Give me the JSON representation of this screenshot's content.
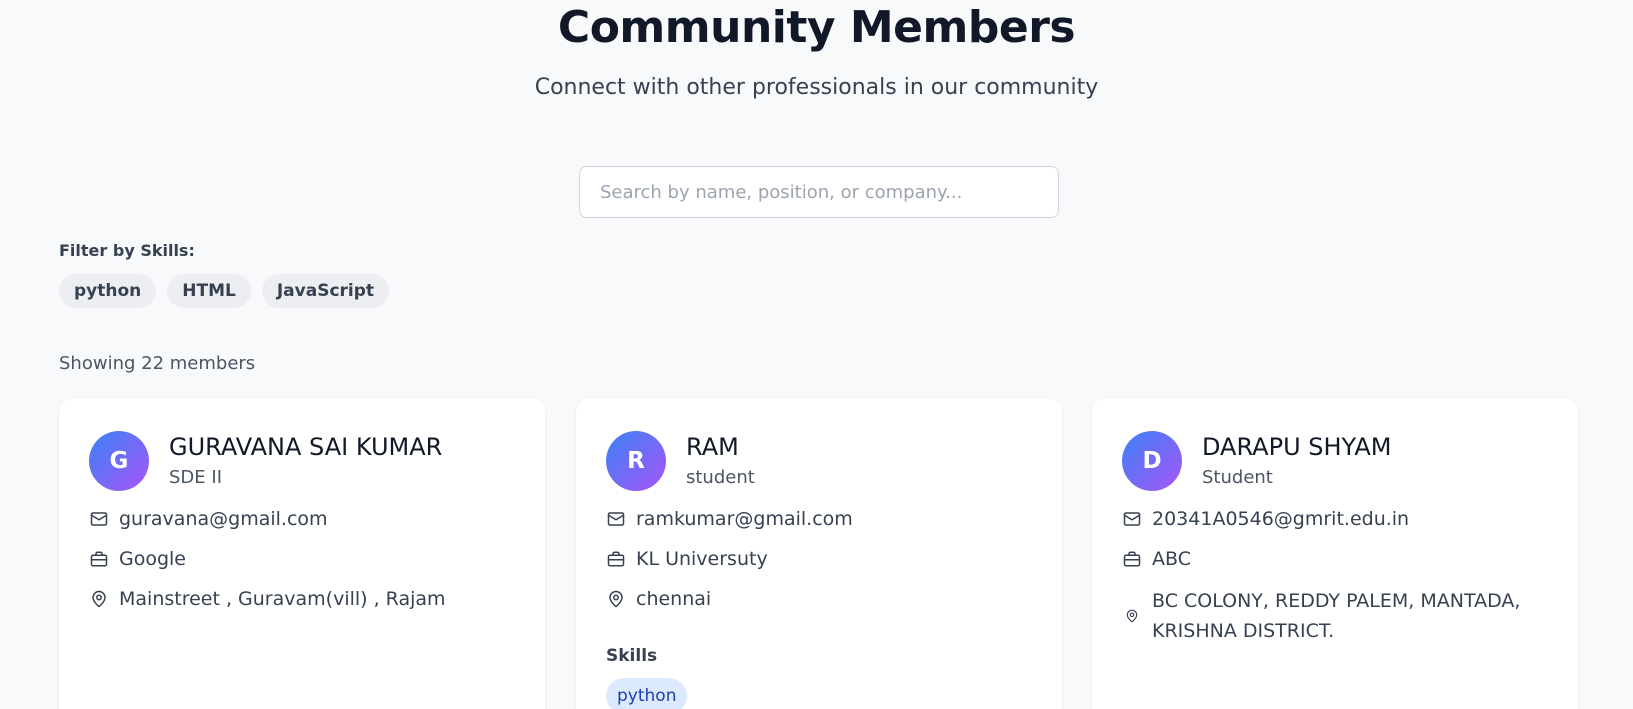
{
  "header": {
    "title": "Community Members",
    "subtitle": "Connect with other professionals in our community"
  },
  "search": {
    "placeholder": "Search by name, position, or company...",
    "value": ""
  },
  "filter": {
    "label": "Filter by Skills:",
    "skills": [
      "python",
      "HTML",
      "JavaScript"
    ]
  },
  "results": {
    "count_text": "Showing 22 members"
  },
  "members": [
    {
      "initial": "G",
      "name": "GURAVANA SAI KUMAR",
      "position": "SDE II",
      "email": "guravana@gmail.com",
      "company": "Google",
      "location": "Mainstreet , Guravam(vill) , Rajam"
    },
    {
      "initial": "R",
      "name": "RAM",
      "position": "student",
      "email": "ramkumar@gmail.com",
      "company": "KL Universuty",
      "location": "chennai",
      "skills_label": "Skills",
      "skills": [
        "python"
      ]
    },
    {
      "initial": "D",
      "name": "DARAPU SHYAM",
      "position": "Student",
      "email": "20341A0546@gmrit.edu.in",
      "company": "ABC",
      "location": "BC COLONY, REDDY PALEM, MANTADA, KRISHNA DISTRICT."
    }
  ],
  "icons": {
    "email": "mail-icon",
    "company": "briefcase-icon",
    "location": "map-pin-icon"
  },
  "colors": {
    "avatar_gradient_start": "#3b82f6",
    "avatar_gradient_end": "#a855f7",
    "skill_tag_bg": "#dbeafe",
    "skill_tag_text": "#1e40af",
    "page_bg": "#f8f9fb"
  }
}
